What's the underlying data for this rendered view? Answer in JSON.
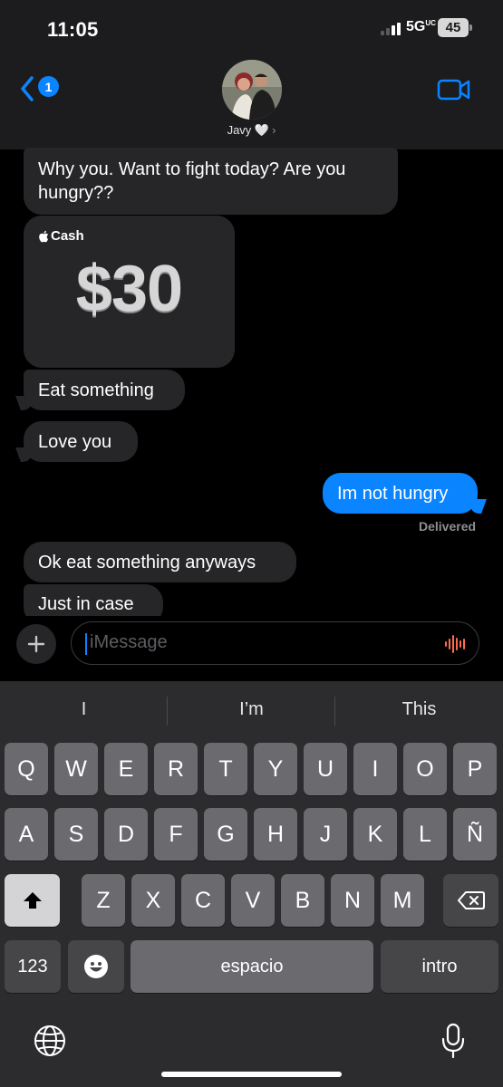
{
  "status_bar": {
    "time": "11:05",
    "network": "5G",
    "network_sub": "UC",
    "battery": "45"
  },
  "header": {
    "back_badge": "1",
    "contact_name": "Javy 🤍",
    "chevron": "›"
  },
  "messages": [
    {
      "side": "in",
      "text_lines": [
        "Why you. Want to fight today? Are you",
        "hungry??"
      ]
    },
    {
      "side": "in",
      "type": "apple_cash",
      "brand": "Cash",
      "amount": "$30"
    },
    {
      "side": "in",
      "text": "Eat something"
    },
    {
      "side": "in",
      "text": "Love you"
    },
    {
      "side": "out",
      "text": "Im not hungry",
      "status": "Delivered"
    },
    {
      "side": "in",
      "text": "Ok eat something anyways"
    },
    {
      "side": "in",
      "text": "Just in case"
    }
  ],
  "compose": {
    "placeholder": "iMessage"
  },
  "keyboard": {
    "suggestions": [
      "I",
      "I’m",
      "This"
    ],
    "row1": [
      "Q",
      "W",
      "E",
      "R",
      "T",
      "Y",
      "U",
      "I",
      "O",
      "P"
    ],
    "row2": [
      "A",
      "S",
      "D",
      "F",
      "G",
      "H",
      "J",
      "K",
      "L",
      "Ñ"
    ],
    "row3": [
      "Z",
      "X",
      "C",
      "V",
      "B",
      "N",
      "M"
    ],
    "numbers_key": "123",
    "space_key": "espacio",
    "return_key": "intro"
  },
  "colors": {
    "accent": "#0a84ff",
    "incoming_bubble": "#262628",
    "outgoing_bubble": "#0a84ff",
    "header_bg": "#1c1c1e",
    "keyboard_bg": "#2c2c2e"
  },
  "icons": [
    "back-chevron-icon",
    "facetime-video-icon",
    "plus-icon",
    "audio-waveform-icon",
    "apple-logo-icon",
    "shift-icon",
    "delete-icon",
    "emoji-icon",
    "globe-icon",
    "microphone-icon"
  ]
}
